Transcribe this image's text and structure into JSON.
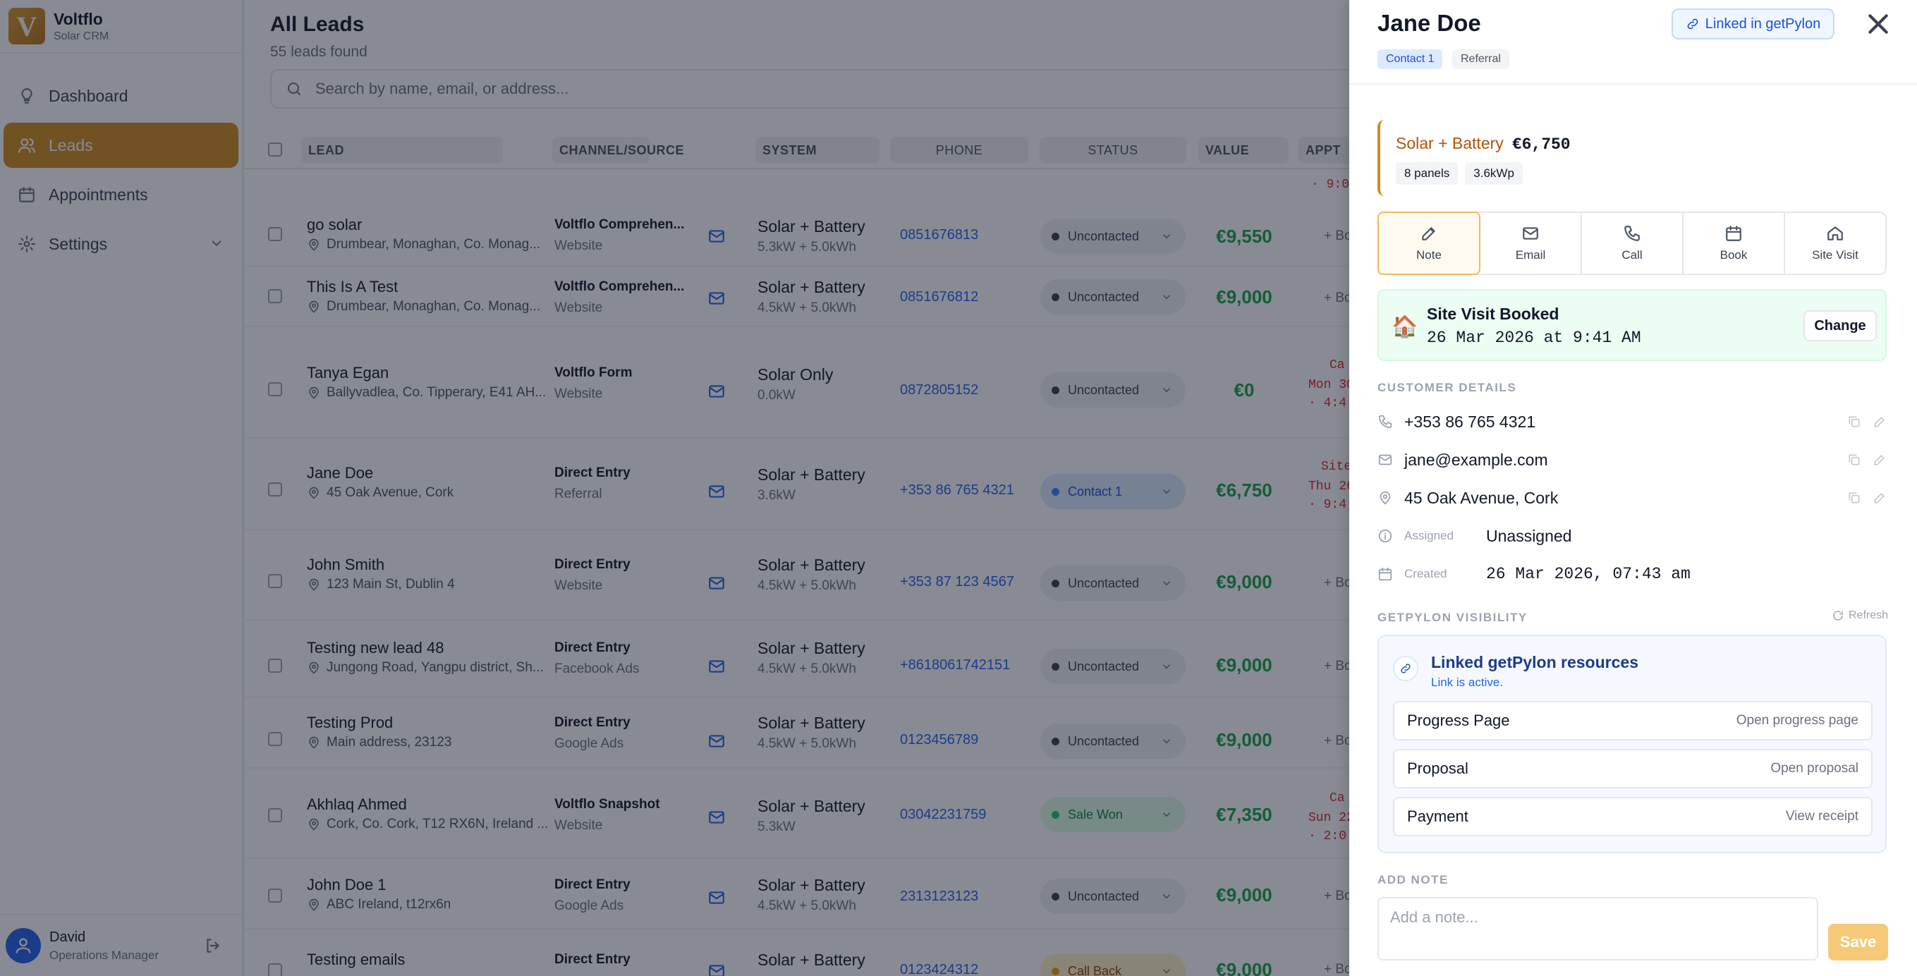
{
  "brand": {
    "logo_letter": "V",
    "name": "Voltflo",
    "subtitle": "Solar CRM"
  },
  "nav": [
    {
      "label": "Dashboard",
      "icon": "lightbulb-icon"
    },
    {
      "label": "Leads",
      "icon": "users-icon",
      "active": true
    },
    {
      "label": "Appointments",
      "icon": "calendar-icon"
    },
    {
      "label": "Settings",
      "icon": "gear-icon"
    }
  ],
  "user": {
    "name": "David",
    "role": "Operations Manager"
  },
  "main": {
    "title": "All Leads",
    "count": "55 leads found",
    "search_placeholder": "Search by name, email, or address..."
  },
  "table": {
    "headers": {
      "lead": "LEAD",
      "channel": "CHANNEL/SOURCE",
      "system": "SYSTEM",
      "phone": "PHONE",
      "status": "STATUS",
      "value": "VALUE",
      "appt": "APPT"
    },
    "top_fragment": "· 9:0",
    "rows": [
      {
        "name": "go solar",
        "address": "Drumbear, Monaghan, Co. Monag...",
        "channel": "Voltflo Comprehen...",
        "source": "Website",
        "system": "Solar + Battery",
        "system_detail": "5.3kW + 5.0kWh",
        "phone": "0851676813",
        "status": "Uncontacted",
        "status_style": "grey",
        "value": "€9,550",
        "appt": "+ Bo"
      },
      {
        "name": "This Is A Test",
        "address": "Drumbear, Monaghan, Co. Monag...",
        "channel": "Voltflo Comprehen...",
        "source": "Website",
        "system": "Solar + Battery",
        "system_detail": "4.5kW + 5.0kWh",
        "phone": "0851676812",
        "status": "Uncontacted",
        "status_style": "grey",
        "value": "€9,000",
        "appt": "+ Bo"
      },
      {
        "name": "Tanya Egan",
        "address": "Ballyvadlea, Co. Tipperary, E41 AH...",
        "channel": "Voltflo Form",
        "source": "Website",
        "system": "Solar Only",
        "system_detail": "0.0kW",
        "phone": "0872805152",
        "status": "Uncontacted",
        "status_style": "grey",
        "value": "€0",
        "appt_lines": [
          "Ca",
          "Mon 30",
          "· 4:4"
        ]
      },
      {
        "name": "Jane Doe",
        "address": "45 Oak Avenue, Cork",
        "channel": "Direct Entry",
        "source": "Referral",
        "system": "Solar + Battery",
        "system_detail": "3.6kW",
        "phone": "+353 86 765 4321",
        "status": "Contact 1",
        "status_style": "blue",
        "value": "€6,750",
        "appt_lines": [
          "Site V",
          "Thu 26",
          "· 9:4"
        ]
      },
      {
        "name": "John Smith",
        "address": "123 Main St, Dublin 4",
        "channel": "Direct Entry",
        "source": "Website",
        "system": "Solar + Battery",
        "system_detail": "4.5kW + 5.0kWh",
        "phone": "+353 87 123 4567",
        "status": "Uncontacted",
        "status_style": "grey",
        "value": "€9,000",
        "appt": "+ Bo"
      },
      {
        "name": "Testing new lead 48",
        "address": "Jungong Road, Yangpu district, Sh...",
        "channel": "Direct Entry",
        "source": "Facebook Ads",
        "system": "Solar + Battery",
        "system_detail": "4.5kW + 5.0kWh",
        "phone": "+8618061742151",
        "status": "Uncontacted",
        "status_style": "grey",
        "value": "€9,000",
        "appt": "+ Bo"
      },
      {
        "name": "Testing Prod",
        "address": "Main address, 23123",
        "channel": "Direct Entry",
        "source": "Google Ads",
        "system": "Solar + Battery",
        "system_detail": "4.5kW + 5.0kWh",
        "phone": "0123456789",
        "status": "Uncontacted",
        "status_style": "grey",
        "value": "€9,000",
        "appt": "+ Bo"
      },
      {
        "name": "Akhlaq Ahmed",
        "address": "Cork, Co. Cork, T12 RX6N, Ireland ...",
        "channel": "Voltflo Snapshot",
        "source": "Website",
        "system": "Solar + Battery",
        "system_detail": "5.3kW",
        "phone": "03042231759",
        "status": "Sale Won",
        "status_style": "green",
        "value": "€7,350",
        "appt_lines": [
          "Ca",
          "Sun 22",
          "· 2:0"
        ]
      },
      {
        "name": "John Doe 1",
        "address": "ABC Ireland, t12rx6n",
        "channel": "Direct Entry",
        "source": "Google Ads",
        "system": "Solar + Battery",
        "system_detail": "4.5kW + 5.0kWh",
        "phone": "2313123123",
        "status": "Uncontacted",
        "status_style": "grey",
        "value": "€9,000",
        "appt": "+ Bo"
      },
      {
        "name": "Testing emails",
        "address": "",
        "channel": "Direct Entry",
        "source": "",
        "system": "Solar + Battery",
        "system_detail": "",
        "phone": "0123424312",
        "status": "Call Back",
        "status_style": "yellow",
        "value": "€9,000",
        "appt": "+ Bo"
      }
    ]
  },
  "drawer": {
    "name": "Jane Doe",
    "tags": [
      "Contact 1",
      "Referral"
    ],
    "linked_label": "Linked in getPylon",
    "system_type": "Solar + Battery",
    "system_price": "€6,750",
    "chips": [
      "8 panels",
      "3.6kWp"
    ],
    "actions": [
      {
        "label": "Note",
        "icon": "pencil-icon",
        "active": true
      },
      {
        "label": "Email",
        "icon": "mail-icon"
      },
      {
        "label": "Call",
        "icon": "phone-icon"
      },
      {
        "label": "Book",
        "icon": "calendar-icon"
      },
      {
        "label": "Site Visit",
        "icon": "home-icon"
      }
    ],
    "visit": {
      "icon": "🏠",
      "title": "Site Visit Booked",
      "date": "26 Mar 2026 at 9:41 AM",
      "change_label": "Change"
    },
    "customer_label": "CUSTOMER DETAILS",
    "phone": "+353 86 765 4321",
    "email": "jane@example.com",
    "address": "45 Oak Avenue, Cork",
    "assigned_label": "Assigned",
    "assigned_value": "Unassigned",
    "created_label": "Created",
    "created_value": "26 Mar 2026, 07:43 am",
    "getpylon_label": "GETPYLON VISIBILITY",
    "refresh_label": "Refresh",
    "gp_title": "Linked getPylon resources",
    "gp_sub": "Link is active.",
    "gp_rows": [
      {
        "label": "Progress Page",
        "action": "Open progress page"
      },
      {
        "label": "Proposal",
        "action": "Open proposal"
      },
      {
        "label": "Payment",
        "action": "View receipt"
      }
    ],
    "note_label": "ADD NOTE",
    "note_placeholder": "Add a note...",
    "save_label": "Save"
  }
}
